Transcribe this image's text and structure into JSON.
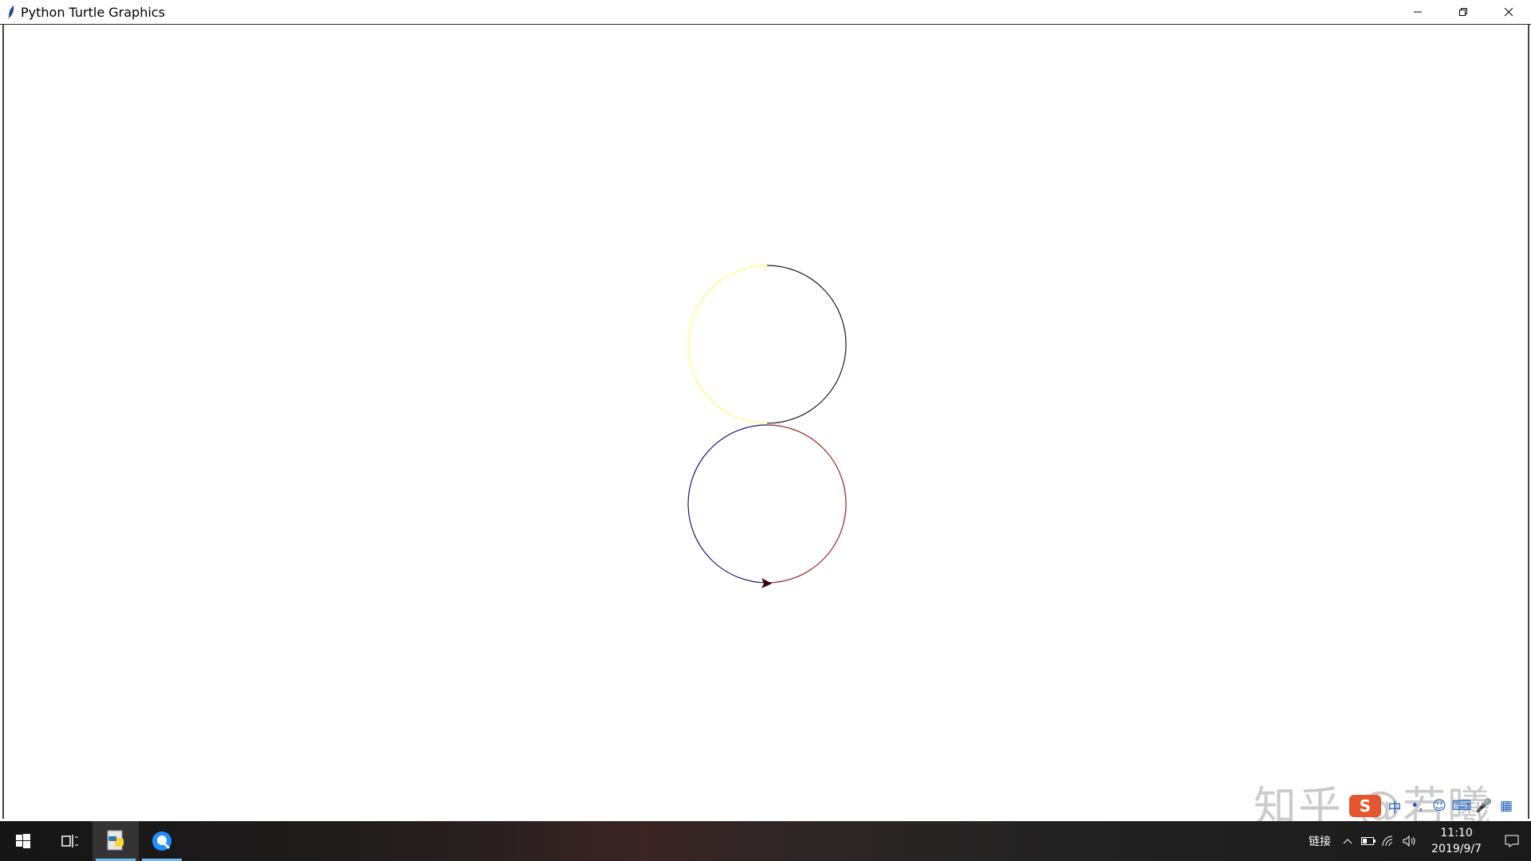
{
  "window": {
    "title": "Python Turtle Graphics",
    "controls": {
      "minimize": "minimize-icon",
      "restore": "restore-icon",
      "close": "close-icon"
    }
  },
  "drawing": {
    "colors": {
      "top_left_arc": "#ffff66",
      "top_right_arc": "#1a1a1a",
      "bottom_left_arc": "#1a1a70",
      "bottom_right_arc": "#a02020",
      "turtle": "#3a0000"
    }
  },
  "watermark": {
    "text": "知乎 @若曦"
  },
  "ime": {
    "logo": "S",
    "items": [
      "中",
      "•,",
      "☺",
      "⌨",
      "🎤",
      "▦"
    ]
  },
  "taskbar": {
    "apps": [
      "windows-start-icon",
      "task-view-icon",
      "python-app-icon",
      "browser-app-icon"
    ],
    "tray": {
      "link_text": "链接",
      "time": "11:10",
      "date": "2019/9/7"
    }
  }
}
